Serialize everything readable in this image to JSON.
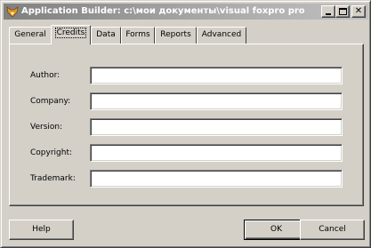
{
  "window": {
    "title": "Application Builder: c:\\мои документы\\visual foxpro projects\\sal..."
  },
  "tabs": [
    {
      "label": "General",
      "active": false
    },
    {
      "label": "Credits",
      "active": true
    },
    {
      "label": "Data",
      "active": false
    },
    {
      "label": "Forms",
      "active": false
    },
    {
      "label": "Reports",
      "active": false
    },
    {
      "label": "Advanced",
      "active": false
    }
  ],
  "credits": {
    "author_label": "Author:",
    "author_value": "",
    "company_label": "Company:",
    "company_value": "",
    "version_label": "Version:",
    "version_value": "",
    "copyright_label": "Copyright:",
    "copyright_value": "",
    "trademark_label": "Trademark:",
    "trademark_value": ""
  },
  "buttons": {
    "help": "Help",
    "ok": "OK",
    "cancel": "Cancel"
  },
  "icons": {
    "app": "foxpro-icon",
    "minimize": "minimize-icon",
    "maximize": "maximize-icon",
    "close": "close-icon"
  },
  "colors": {
    "face": "#d4d0c8",
    "titlebar_inactive": "#808080"
  }
}
